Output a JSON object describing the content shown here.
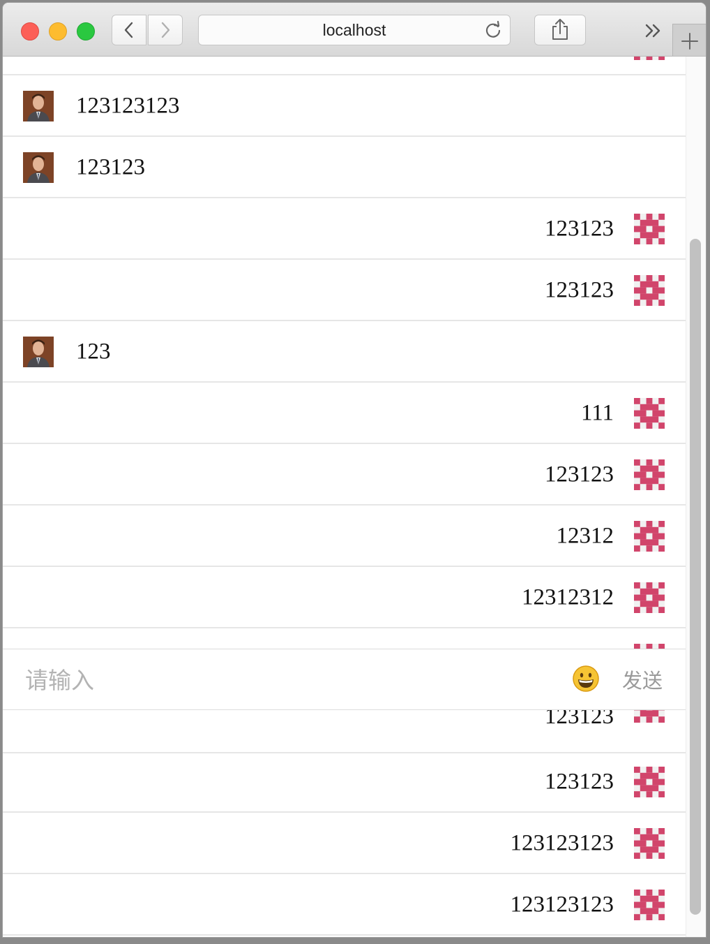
{
  "browser": {
    "address": "localhost",
    "buttons": {
      "back": "back",
      "forward": "forward",
      "share": "share",
      "overflow": "overflow",
      "new_tab": "new-tab"
    }
  },
  "messages": [
    {
      "side": "right",
      "text": ""
    },
    {
      "side": "left",
      "text": "123123123"
    },
    {
      "side": "left",
      "text": "123123"
    },
    {
      "side": "right",
      "text": "123123"
    },
    {
      "side": "right",
      "text": "123123"
    },
    {
      "side": "left",
      "text": "123"
    },
    {
      "side": "right",
      "text": "111"
    },
    {
      "side": "right",
      "text": "123123"
    },
    {
      "side": "right",
      "text": "12312"
    },
    {
      "side": "right",
      "text": "12312312"
    },
    {
      "side": "right",
      "text": ""
    },
    {
      "side": "right",
      "text": "123123"
    },
    {
      "side": "right",
      "text": "123123"
    },
    {
      "side": "right",
      "text": "123123123"
    },
    {
      "side": "right",
      "text": "123123123"
    }
  ],
  "composer": {
    "placeholder": "请输入",
    "value": "",
    "emoji_icon": "grinning-face-emoji-icon",
    "send_label": "发送"
  },
  "colors": {
    "identicon": "#d1456b",
    "placeholder": "#b3b3b3",
    "send": "#9a9a9a"
  }
}
